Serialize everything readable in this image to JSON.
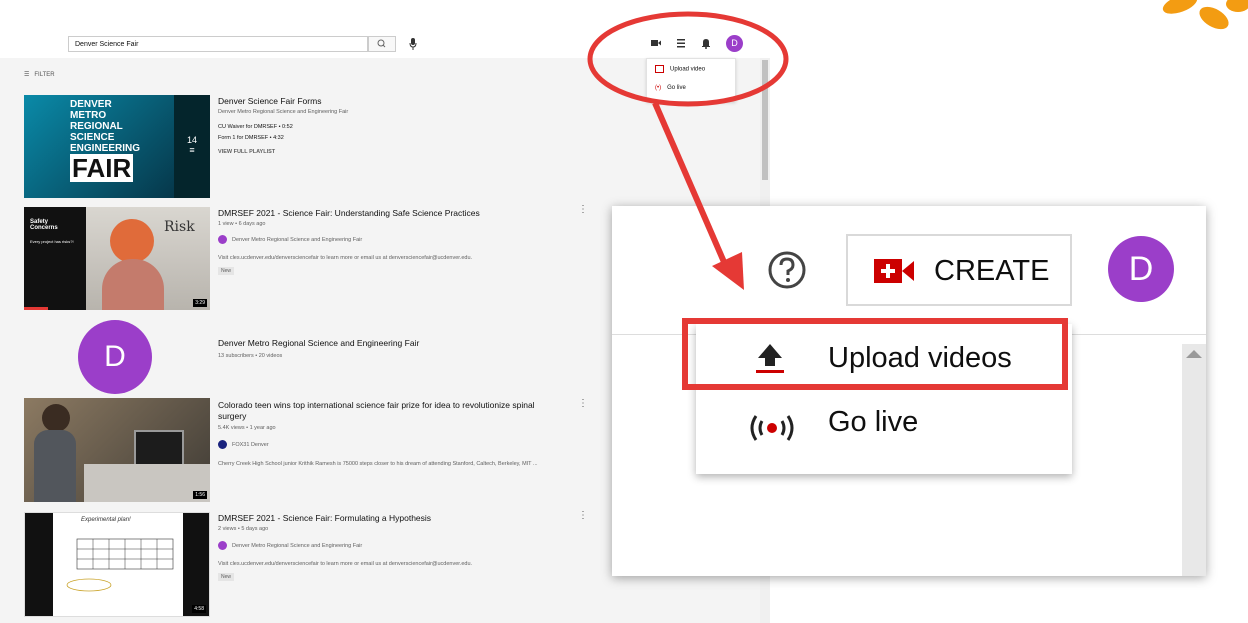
{
  "header": {
    "search_value": "Denver Science Fair"
  },
  "mini_menu": {
    "upload_label": "Upload video",
    "golive_label": "Go live"
  },
  "avatar_initial": "D",
  "filter_label": "FILTER",
  "results": {
    "playlist": {
      "title": "Denver Science Fair Forms",
      "channel": "Denver Metro Regional Science and Engineering Fair",
      "items": [
        "CU Waiver for DMRSEF • 0:52",
        "Form 1 for DMRSEF • 4:32"
      ],
      "view_all": "VIEW FULL PLAYLIST",
      "count": "14",
      "thumb_lines": [
        "DENVER",
        "METRO",
        "REGIONAL",
        "SCIENCE",
        "ENGINEERING",
        "FAIR"
      ]
    },
    "video1": {
      "title": "DMRSEF 2021 - Science Fair: Understanding Safe Science Practices",
      "meta": "1 view • 6 days ago",
      "channel": "Denver Metro Regional Science and Engineering Fair",
      "desc": "Visit cles.ucdenver.edu/denversciencefair to learn more or email us at denversciencefair@ucdenver.edu.",
      "badge": "New",
      "duration": "3:29",
      "thumb_text_a": "Safety Concerns",
      "thumb_text_b": "Every project has risks?!",
      "thumb_text_c": "Risk"
    },
    "channel": {
      "name": "Denver Metro Regional Science and Engineering Fair",
      "meta": "13 subscribers • 20 videos"
    },
    "video2": {
      "title": "Colorado teen wins top international science fair prize for idea to revolutionize spinal surgery",
      "meta": "5.4K views • 1 year ago",
      "channel": "FOX31 Denver",
      "desc": "Cherry Creek High School junior Krithik Ramesh is 75000 steps closer to his dream of attending Stanford, Caltech, Berkeley, MIT ...",
      "duration": "1:56"
    },
    "video3": {
      "title": "DMRSEF 2021 - Science Fair: Formulating a Hypothesis",
      "meta": "2 views • 5 days ago",
      "channel": "Denver Metro Regional Science and Engineering Fair",
      "desc": "Visit cles.ucdenver.edu/denversciencefair to learn more or email us at denversciencefair@ucdenver.edu.",
      "badge": "New",
      "duration": "4:58",
      "thumb_text": "Experimental plan!"
    }
  },
  "zoom": {
    "create_label": "CREATE",
    "upload_label": "Upload videos",
    "golive_label": "Go live",
    "avatar_initial": "D"
  },
  "colors": {
    "annotation_red": "#e53935",
    "avatar_purple": "#9b3ec9",
    "youtube_red": "#cc0000",
    "logo_orange": "#f39c12"
  }
}
